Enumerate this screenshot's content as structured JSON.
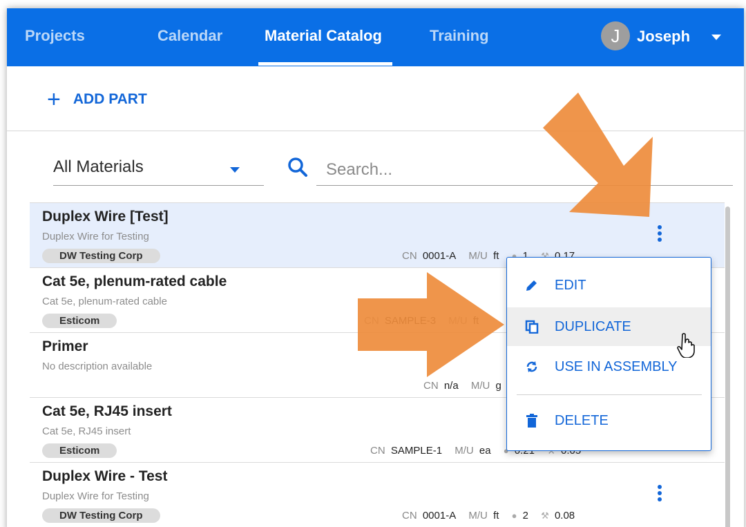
{
  "nav": {
    "items": [
      {
        "label": "Projects",
        "active": false
      },
      {
        "label": "Calendar",
        "active": false
      },
      {
        "label": "Material Catalog",
        "active": true
      },
      {
        "label": "Training",
        "active": false
      }
    ],
    "user": {
      "initial": "J",
      "name": "Joseph"
    }
  },
  "toolbar": {
    "add_part_label": "ADD PART"
  },
  "filter": {
    "selected": "All Materials"
  },
  "search": {
    "placeholder": "Search..."
  },
  "items": [
    {
      "title": "Duplex Wire [Test]",
      "description": "Duplex Wire for Testing",
      "vendor": "DW Testing Corp",
      "cn_label": "CN",
      "cn": "0001-A",
      "mu_label": "M/U",
      "mu": "ft",
      "tag_count": "1",
      "labor": "0.17"
    },
    {
      "title": "Cat 5e, plenum-rated cable",
      "description": "Cat 5e, plenum-rated cable",
      "vendor": "Esticom",
      "cn_label": "CN",
      "cn": "SAMPLE-3",
      "mu_label": "M/U",
      "mu": "ft"
    },
    {
      "title": "Primer",
      "description": "No description available",
      "cn_label": "CN",
      "cn": "n/a",
      "mu_label": "M/U",
      "mu": "g"
    },
    {
      "title": "Cat 5e, RJ45 insert",
      "description": "Cat 5e, RJ45 insert",
      "vendor": "Esticom",
      "cn_label": "CN",
      "cn": "SAMPLE-1",
      "mu_label": "M/U",
      "mu": "ea",
      "tag_count": "0.21",
      "labor": "0.05"
    },
    {
      "title": "Duplex Wire - Test",
      "description": "Duplex Wire for Testing",
      "vendor": "DW Testing Corp",
      "cn_label": "CN",
      "cn": "0001-A",
      "mu_label": "M/U",
      "mu": "ft",
      "tag_count": "2",
      "labor": "0.08"
    }
  ],
  "context_menu": {
    "edit": "EDIT",
    "duplicate": "DUPLICATE",
    "use_in_assembly": "USE IN ASSEMBLY",
    "delete": "DELETE"
  },
  "colors": {
    "nav_bg": "#0a6fe6",
    "accent": "#1266d8",
    "selected_row": "#e6eefc",
    "annotation_arrow": "#ee8c3c"
  }
}
